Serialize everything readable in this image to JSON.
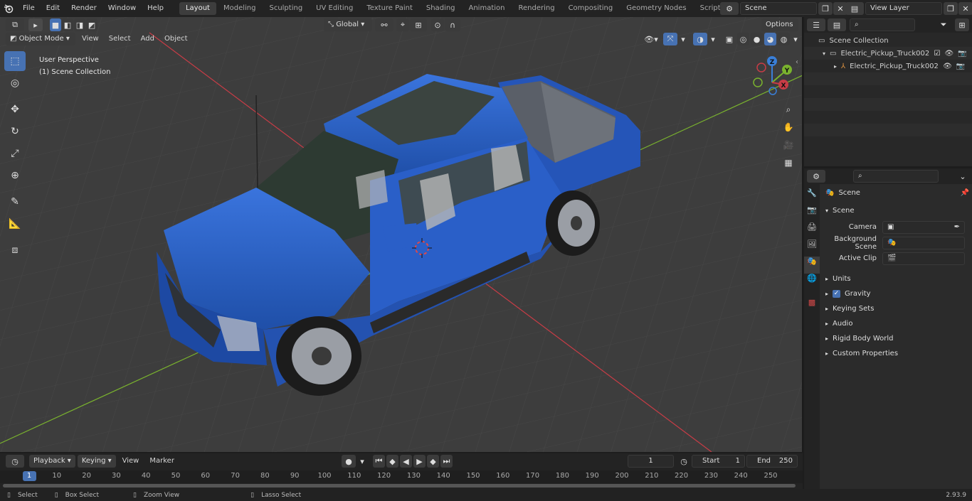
{
  "topbar": {
    "menus": [
      "File",
      "Edit",
      "Render",
      "Window",
      "Help"
    ],
    "workspaces": [
      "Layout",
      "Modeling",
      "Sculpting",
      "UV Editing",
      "Texture Paint",
      "Shading",
      "Animation",
      "Rendering",
      "Compositing",
      "Geometry Nodes",
      "Scripting"
    ],
    "active_workspace": "Layout",
    "scene_name": "Scene",
    "view_layer": "View Layer"
  },
  "viewport": {
    "mode": "Object Mode",
    "menus": [
      "View",
      "Select",
      "Add",
      "Object"
    ],
    "transform_orientation": "Global",
    "options_label": "Options",
    "overlay_title": "User Perspective",
    "overlay_subtitle": "(1) Scene Collection",
    "gizmo_axes": [
      "Z",
      "Y",
      "X"
    ]
  },
  "outliner": {
    "root": "Scene Collection",
    "items": [
      {
        "label": "Electric_Pickup_Truck002",
        "type": "collection"
      },
      {
        "label": "Electric_Pickup_Truck002",
        "type": "object"
      }
    ]
  },
  "properties": {
    "context_title": "Scene",
    "section": "Scene",
    "fields": [
      {
        "label": "Camera"
      },
      {
        "label": "Background Scene"
      },
      {
        "label": "Active Clip"
      }
    ],
    "panels": [
      "Units",
      "Gravity",
      "Keying Sets",
      "Audio",
      "Rigid Body World",
      "Custom Properties"
    ]
  },
  "timeline": {
    "menus": [
      "Playback",
      "Keying",
      "View",
      "Marker"
    ],
    "current_frame": "1",
    "start_label": "Start",
    "start_value": "1",
    "end_label": "End",
    "end_value": "250",
    "ruler": [
      "1",
      "10",
      "20",
      "30",
      "40",
      "50",
      "60",
      "70",
      "80",
      "90",
      "100",
      "110",
      "120",
      "130",
      "140",
      "150",
      "160",
      "170",
      "180",
      "190",
      "200",
      "210",
      "220",
      "230",
      "240",
      "250"
    ]
  },
  "statusbar": {
    "hints": [
      "Select",
      "Box Select",
      "Zoom View",
      "Lasso Select"
    ],
    "version": "2.93.9"
  },
  "colors": {
    "accent": "#4772b3",
    "truck_body": "#2d62c8",
    "axis_x": "#c83c46",
    "axis_y": "#7ab32e",
    "axis_z": "#3a7fd8"
  }
}
